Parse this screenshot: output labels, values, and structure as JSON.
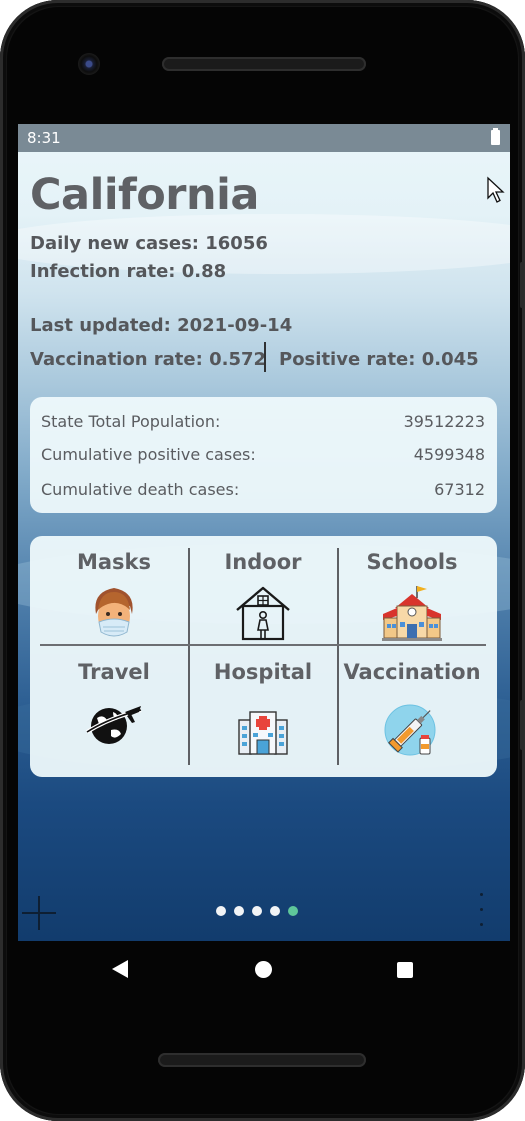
{
  "status_bar": {
    "time": "8:31"
  },
  "state": {
    "name": "California",
    "daily_new_cases_text": "Daily new cases: 16056",
    "infection_rate_text": "Infection rate: 0.88",
    "last_updated_text": "Last updated: 2021-09-14",
    "vaccination_rate_text": "Vaccination rate: 0.572",
    "positive_rate_text": "Positive rate: 0.045"
  },
  "stats": [
    {
      "label": "State Total Population:",
      "value": "39512223"
    },
    {
      "label": "Cumulative positive cases:",
      "value": "4599348"
    },
    {
      "label": "Cumulative death cases:",
      "value": "67312"
    }
  ],
  "categories": [
    {
      "label": "Masks",
      "icon": "masked-face-icon"
    },
    {
      "label": "Indoor",
      "icon": "house-icon"
    },
    {
      "label": "Schools",
      "icon": "school-building-icon"
    },
    {
      "label": "Travel",
      "icon": "globe-airplane-icon"
    },
    {
      "label": "Hospital",
      "icon": "hospital-building-icon"
    },
    {
      "label": "Vaccination",
      "icon": "syringe-vial-icon"
    }
  ],
  "pager": {
    "count": 5,
    "active_index": 4,
    "active_color": "#5fc79a"
  },
  "navbar": {
    "icons": [
      "back-icon",
      "home-icon",
      "recents-icon"
    ]
  }
}
